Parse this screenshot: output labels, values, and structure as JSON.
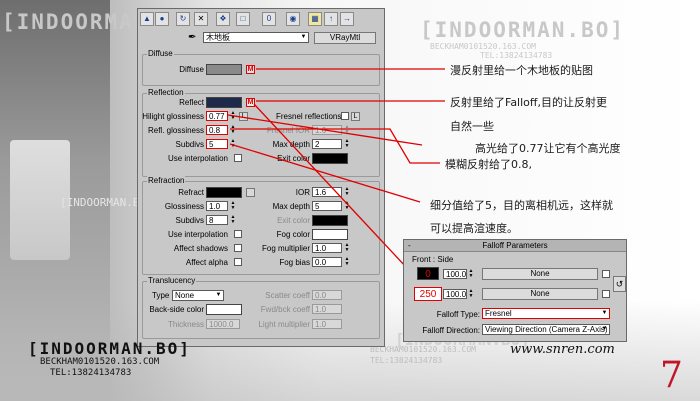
{
  "watermark": {
    "brand": "[INDOORMAN.BO]",
    "email": "BECKHAM0101520.163.COM",
    "tel": "TEL:13824134783",
    "site": "www.snren.com",
    "page_number": "7"
  },
  "panel": {
    "toolbar_icons": [
      "put-to-scene-icon",
      "assign-material-icon",
      "reset-map-icon",
      "delete-icon",
      "make-unique-icon",
      "put-to-library-icon",
      "material-id-icon",
      "show-map-icon",
      "show-end-result-icon",
      "go-to-parent-icon",
      "go-forward-icon"
    ],
    "picker_icon": "eyedropper-icon",
    "material_name": "木地板",
    "material_type": "VRayMtl",
    "diffuse": {
      "title": "Diffuse",
      "label": "Diffuse",
      "color": "#8a8a8a",
      "map_label": "M"
    },
    "reflection": {
      "title": "Reflection",
      "reflect_label": "Reflect",
      "reflect_color": "#1e2a4a",
      "map_label": "M",
      "fresnel_label": "Fresnel reflections",
      "fresnel_lock": "L",
      "hilight_label": "Hilight glossiness",
      "hilight_value": "0.77",
      "hilight_lock": "L",
      "fresnel_ior_label": "Fresnel IOR",
      "fresnel_ior_value": "1.6",
      "refl_gloss_label": "Refl. glossiness",
      "refl_gloss_value": "0.8",
      "max_depth_label": "Max depth",
      "max_depth_value": "2",
      "subdivs_label": "Subdivs",
      "subdivs_value": "5",
      "exit_color_label": "Exit color",
      "use_interp_label": "Use interpolation"
    },
    "refraction": {
      "title": "Refraction",
      "refract_label": "Refract",
      "ior_label": "IOR",
      "ior_value": "1.6",
      "gloss_label": "Glossiness",
      "gloss_value": "1.0",
      "max_depth_label": "Max depth",
      "max_depth_value": "5",
      "subdivs_label": "Subdivs",
      "subdivs_value": "8",
      "exit_color_label": "Exit color",
      "use_interp_label": "Use interpolation",
      "fog_color_label": "Fog color",
      "affect_shadows_label": "Affect shadows",
      "fog_mult_label": "Fog multiplier",
      "fog_mult_value": "1.0",
      "affect_alpha_label": "Affect alpha",
      "fog_bias_label": "Fog bias",
      "fog_bias_value": "0.0"
    },
    "translucency": {
      "title": "Translucency",
      "type_label": "Type",
      "type_value": "None",
      "scatter_label": "Scatter coeff",
      "scatter_value": "0.0",
      "backside_label": "Back-side color",
      "fwd_label": "Fwd/bck coeff",
      "fwd_value": "1.0",
      "thickness_label": "Thickness",
      "thickness_value": "1000.0",
      "light_mult_label": "Light multiplier",
      "light_mult_value": "1.0"
    }
  },
  "falloff": {
    "title": "Falloff Parameters",
    "front_side_label": "Front : Side",
    "row1_value": "0",
    "row1_amount": "100.0",
    "row1_map": "None",
    "row2_value": "250",
    "row2_amount": "100.0",
    "row2_map": "None",
    "swap_icon": "swap-colors-icon",
    "type_label": "Falloff Type:",
    "type_value": "Fresnel",
    "direction_label": "Falloff Direction:",
    "direction_value": "Viewing Direction (Camera Z-Axis)"
  },
  "annotations": {
    "diffuse": "漫反射里给一个木地板的贴图",
    "reflect_line1": "反射里给了Falloff,目的让反射更",
    "reflect_line2": "自然一些",
    "hilight": "高光给了0.77让它有个高光度",
    "refl_gloss": "模糊反射给了0.8,",
    "subdivs_line1": "细分值给了5，目的离相机远，这样就",
    "subdivs_line2": "可以提高渲速度。"
  },
  "colors": {
    "accent_red": "#e00000",
    "panel_bg": "#c8c8c8"
  }
}
